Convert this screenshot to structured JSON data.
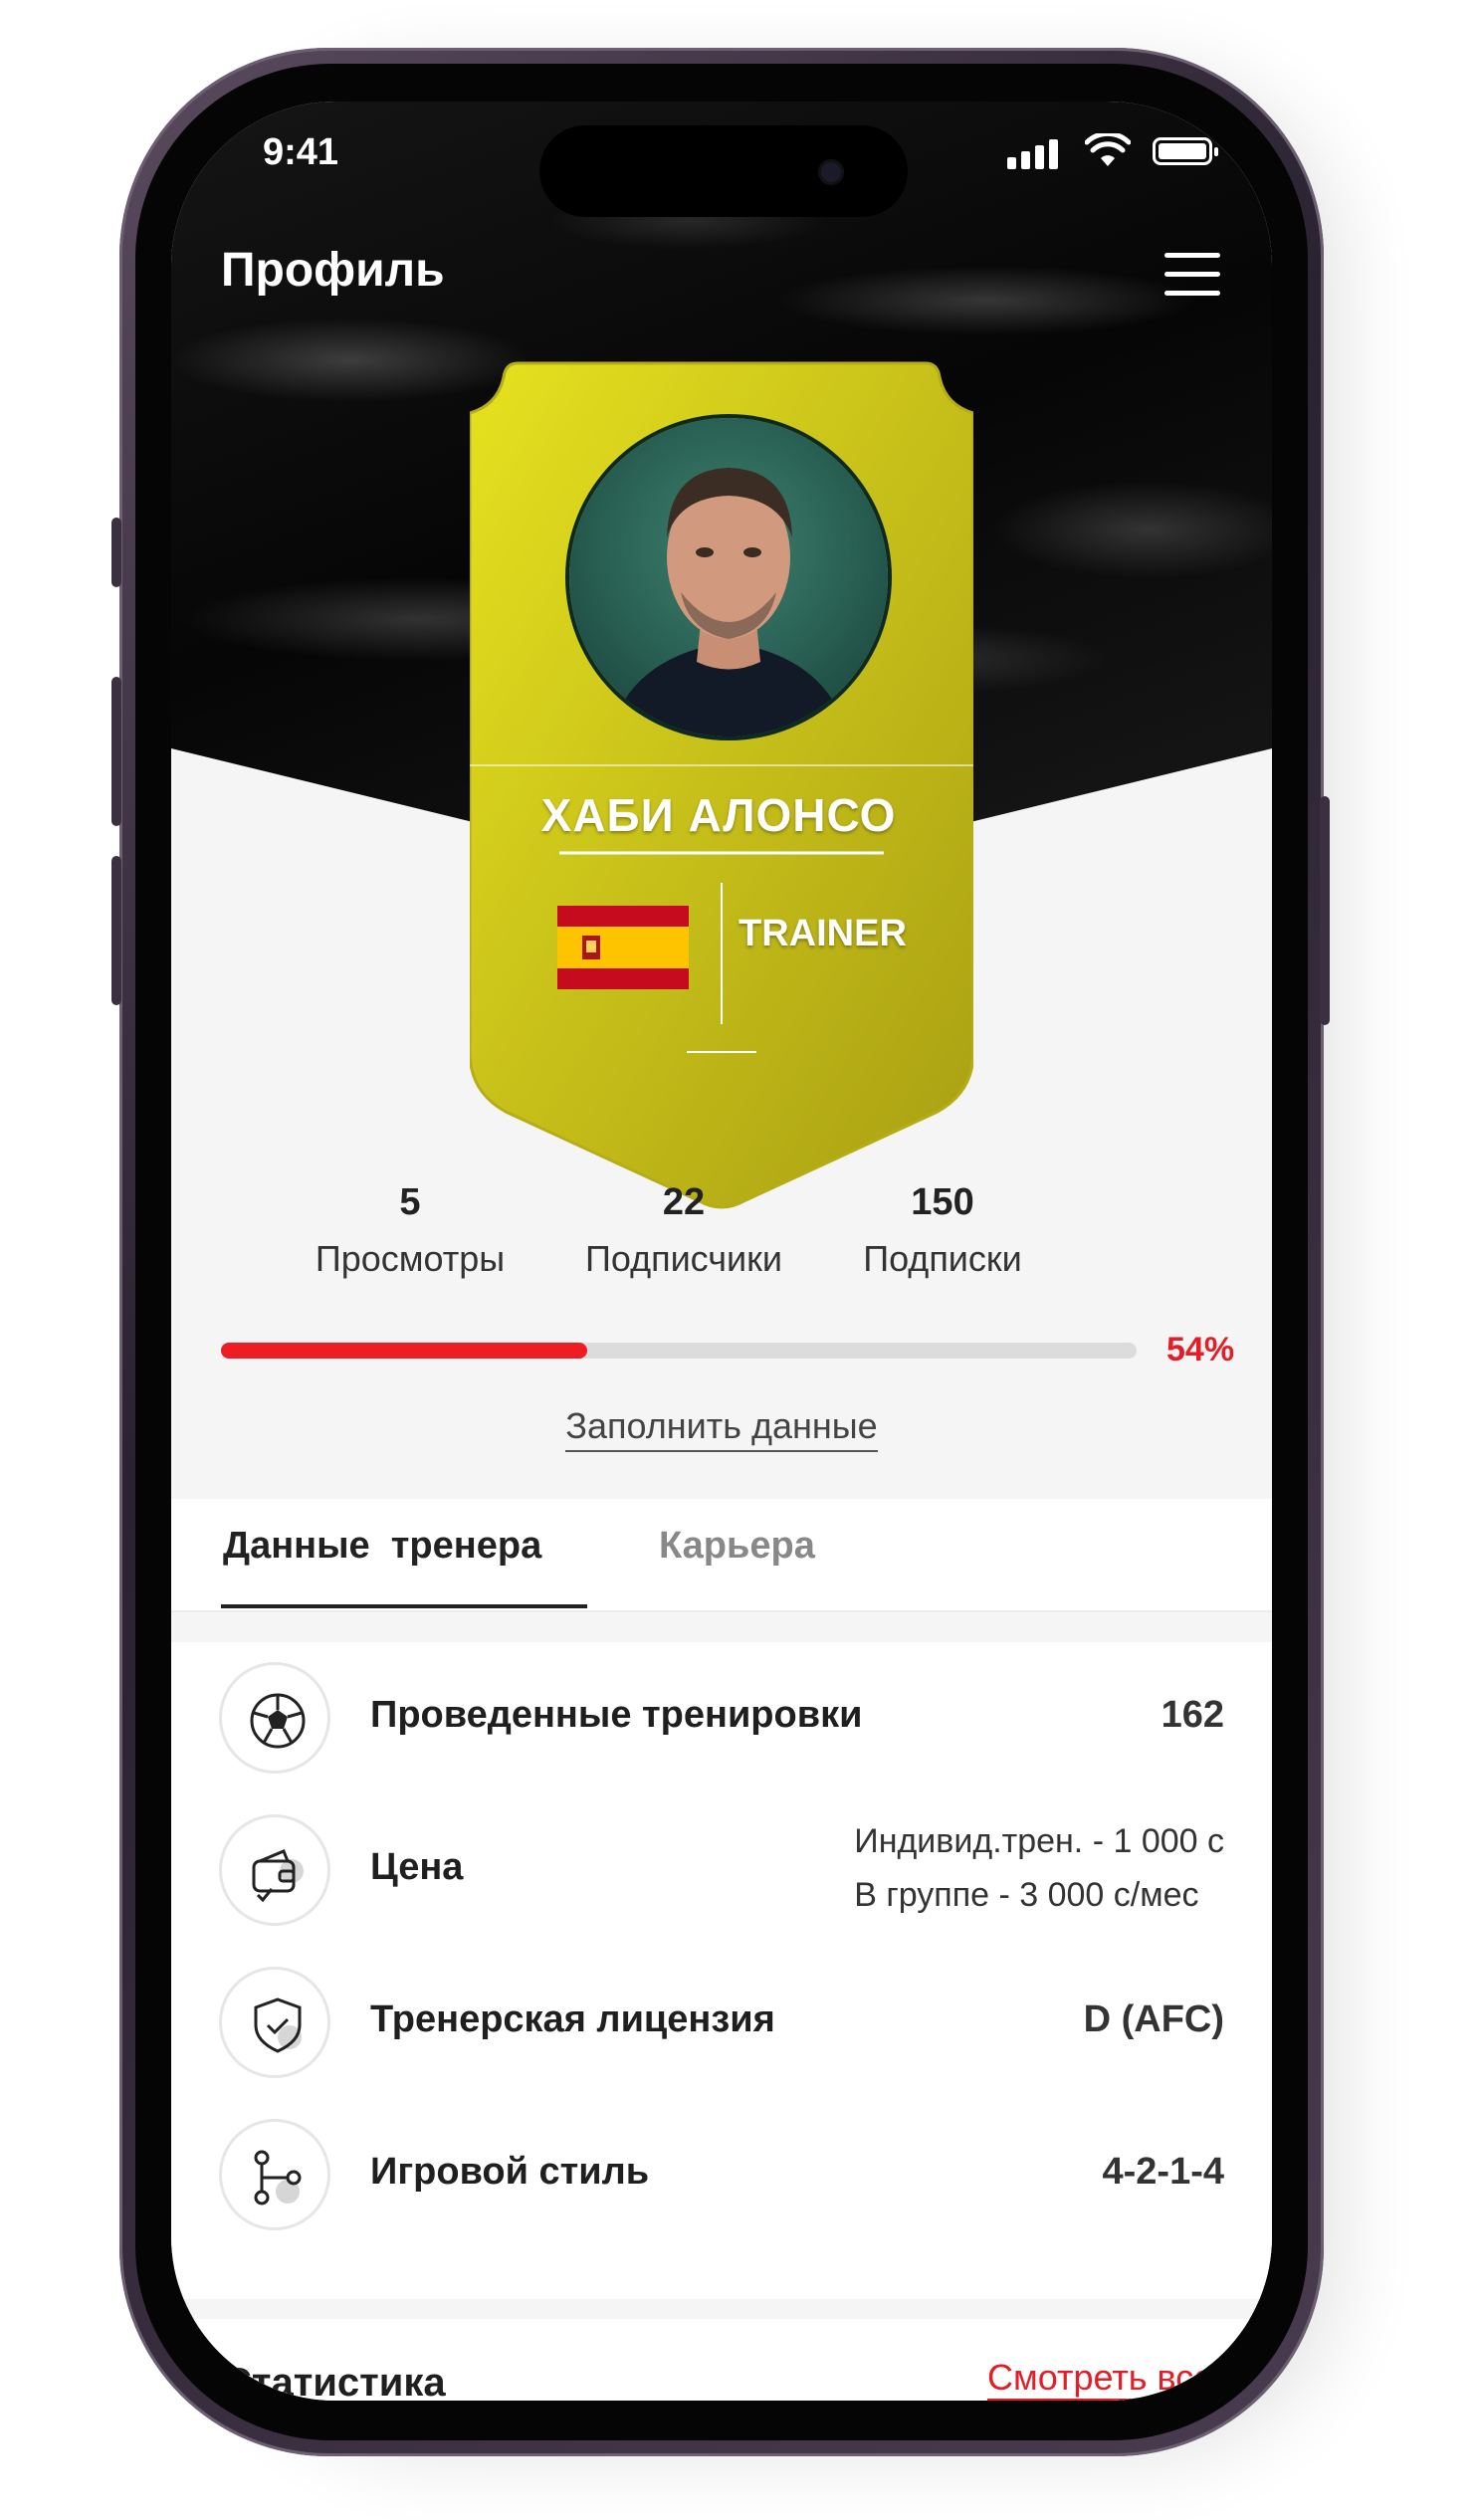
{
  "status_bar": {
    "time": "9:41"
  },
  "header": {
    "title": "Профиль",
    "menu_icon": "hamburger-menu-icon"
  },
  "player_card": {
    "name": "ХАБИ АЛОНСО",
    "role": "TRAINER",
    "flag": "Spain",
    "card_color": "#c8c219"
  },
  "stats": [
    {
      "value": "5",
      "label": "Просмотры"
    },
    {
      "value": "22",
      "label": "Подписчики"
    },
    {
      "value": "150",
      "label": "Подписки"
    }
  ],
  "profile_progress": {
    "percent": 54,
    "label": "54%",
    "color": "#ee1d23"
  },
  "fill_data_link": "Заполнить данные",
  "tabs": [
    {
      "label": "Данные  тренера",
      "active": true
    },
    {
      "label": "Карьера",
      "active": false
    }
  ],
  "info_rows": [
    {
      "icon": "soccer-ball-icon",
      "label": "Проведенные тренировки",
      "value": "162"
    },
    {
      "icon": "wallet-icon",
      "label": "Цена",
      "value_lines": [
        "Индивид.трен. - 1 000 с",
        "В группе - 3 000 с/мес"
      ]
    },
    {
      "icon": "shield-check-icon",
      "label": "Тренерская лицензия",
      "value": "D (AFC)"
    },
    {
      "icon": "branch-icon",
      "label": "Игровой стиль",
      "value": "4-2-1-4"
    }
  ],
  "statistics_section": {
    "title": "Статистика",
    "see_all": "Смотреть все"
  }
}
